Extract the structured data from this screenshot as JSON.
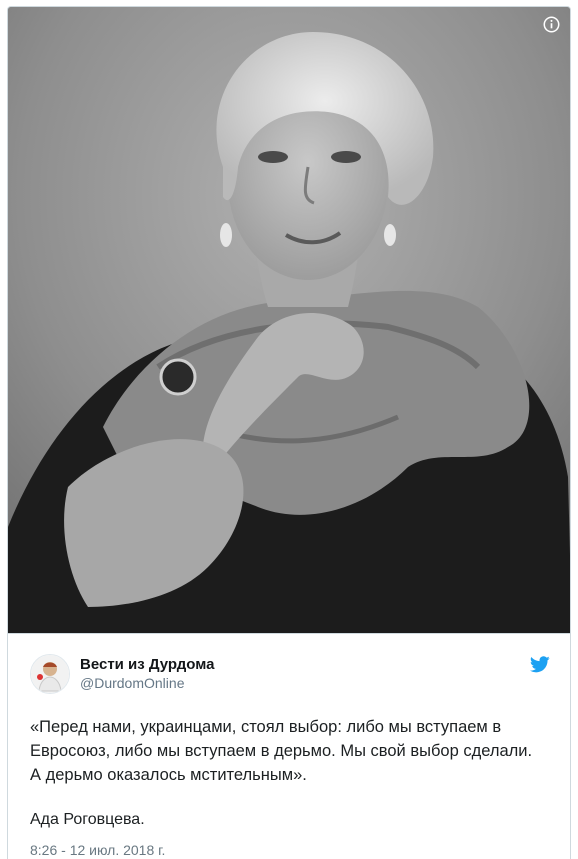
{
  "media": {
    "icon": "info-icon"
  },
  "author": {
    "display_name": "Вести из Дурдома",
    "handle": "@DurdomOnline",
    "avatar_icon": "avatar",
    "brand_icon": "twitter-bird-icon",
    "brand_color": "#1da1f2"
  },
  "tweet": {
    "text": "«Перед нами, украинцами, стоял выбор: либо мы вступаем в Евросоюз, либо мы вступаем в дерьмо. Мы свой выбор сделали. А дерьмо оказалось мстительным».",
    "signature": "Ада Роговцева.",
    "timestamp": "8:26 - 12 июл. 2018 г."
  }
}
